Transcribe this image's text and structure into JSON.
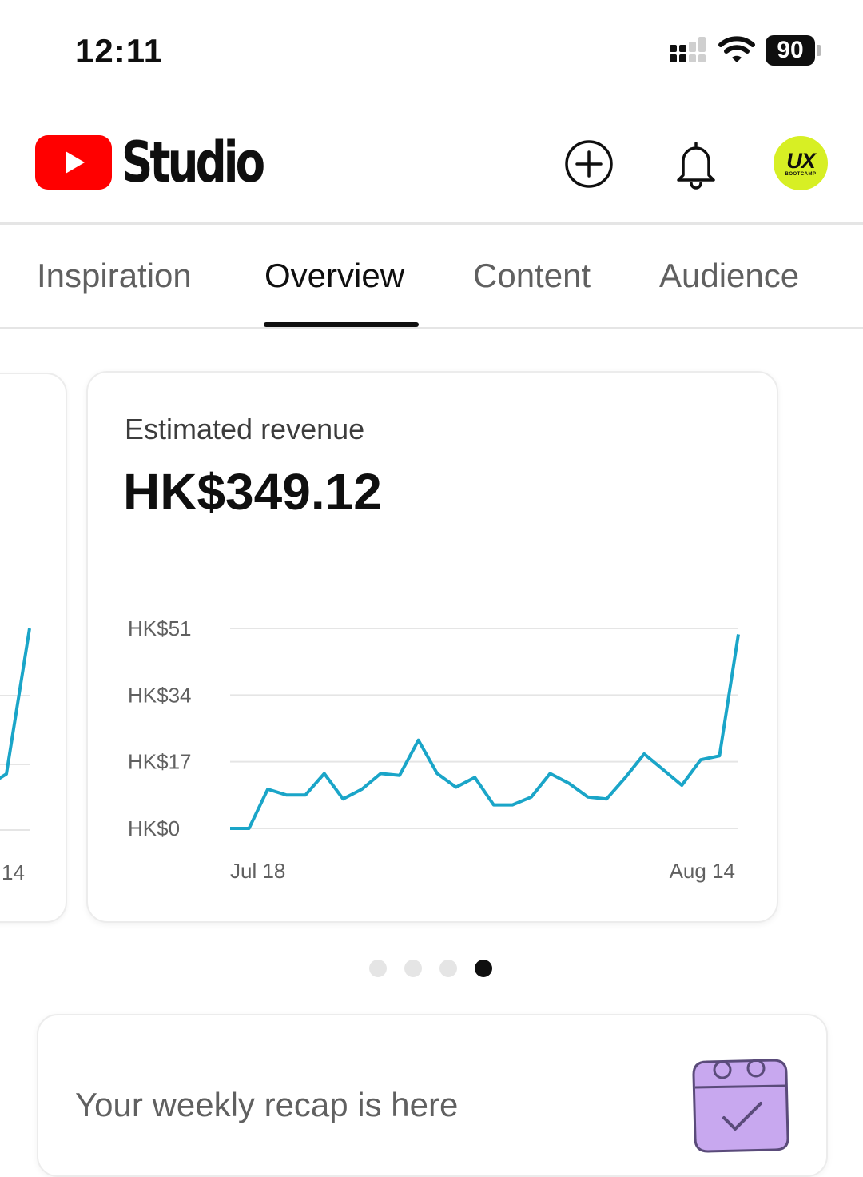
{
  "status_bar": {
    "time": "12:11",
    "battery": "90"
  },
  "header": {
    "app_name": "Studio",
    "avatar_text": "UX",
    "avatar_subtext": "BOOTCAMP",
    "icons": [
      "youtube-logo-icon",
      "create-plus-icon",
      "notification-bell-icon"
    ]
  },
  "tabs": [
    {
      "label": "Inspiration",
      "active": false
    },
    {
      "label": "Overview",
      "active": true
    },
    {
      "label": "Content",
      "active": false
    },
    {
      "label": "Audience",
      "active": false
    }
  ],
  "prev_card": {
    "x_label": "14"
  },
  "revenue_card": {
    "title": "Estimated revenue",
    "value": "HK$349.12"
  },
  "chart_data": {
    "type": "line",
    "y_ticks": [
      "HK$0",
      "HK$17",
      "HK$34",
      "HK$51"
    ],
    "y_tick_values": [
      0,
      17,
      34,
      51
    ],
    "ylim": [
      0,
      51
    ],
    "x_labels": [
      "Jul 18",
      "Aug 14"
    ],
    "grid": true,
    "color": "#1aa5c8",
    "series": [
      {
        "values": [
          0,
          0,
          10,
          8.5,
          8.5,
          14,
          7.5,
          10,
          14,
          13.5,
          22.5,
          14,
          10.5,
          13,
          6,
          6,
          8,
          14,
          11.5,
          8,
          7.5,
          13,
          19,
          15,
          11,
          17.5,
          18.5,
          49.5
        ]
      }
    ]
  },
  "pagination": {
    "count": 4,
    "active_index": 3
  },
  "recap": {
    "title": "Your weekly recap is here"
  },
  "colors": {
    "youtube_red": "#ff0000",
    "line": "#1aa5c8",
    "avatar_bg": "#d7ef24",
    "recap_art": "#c8a8ef"
  }
}
